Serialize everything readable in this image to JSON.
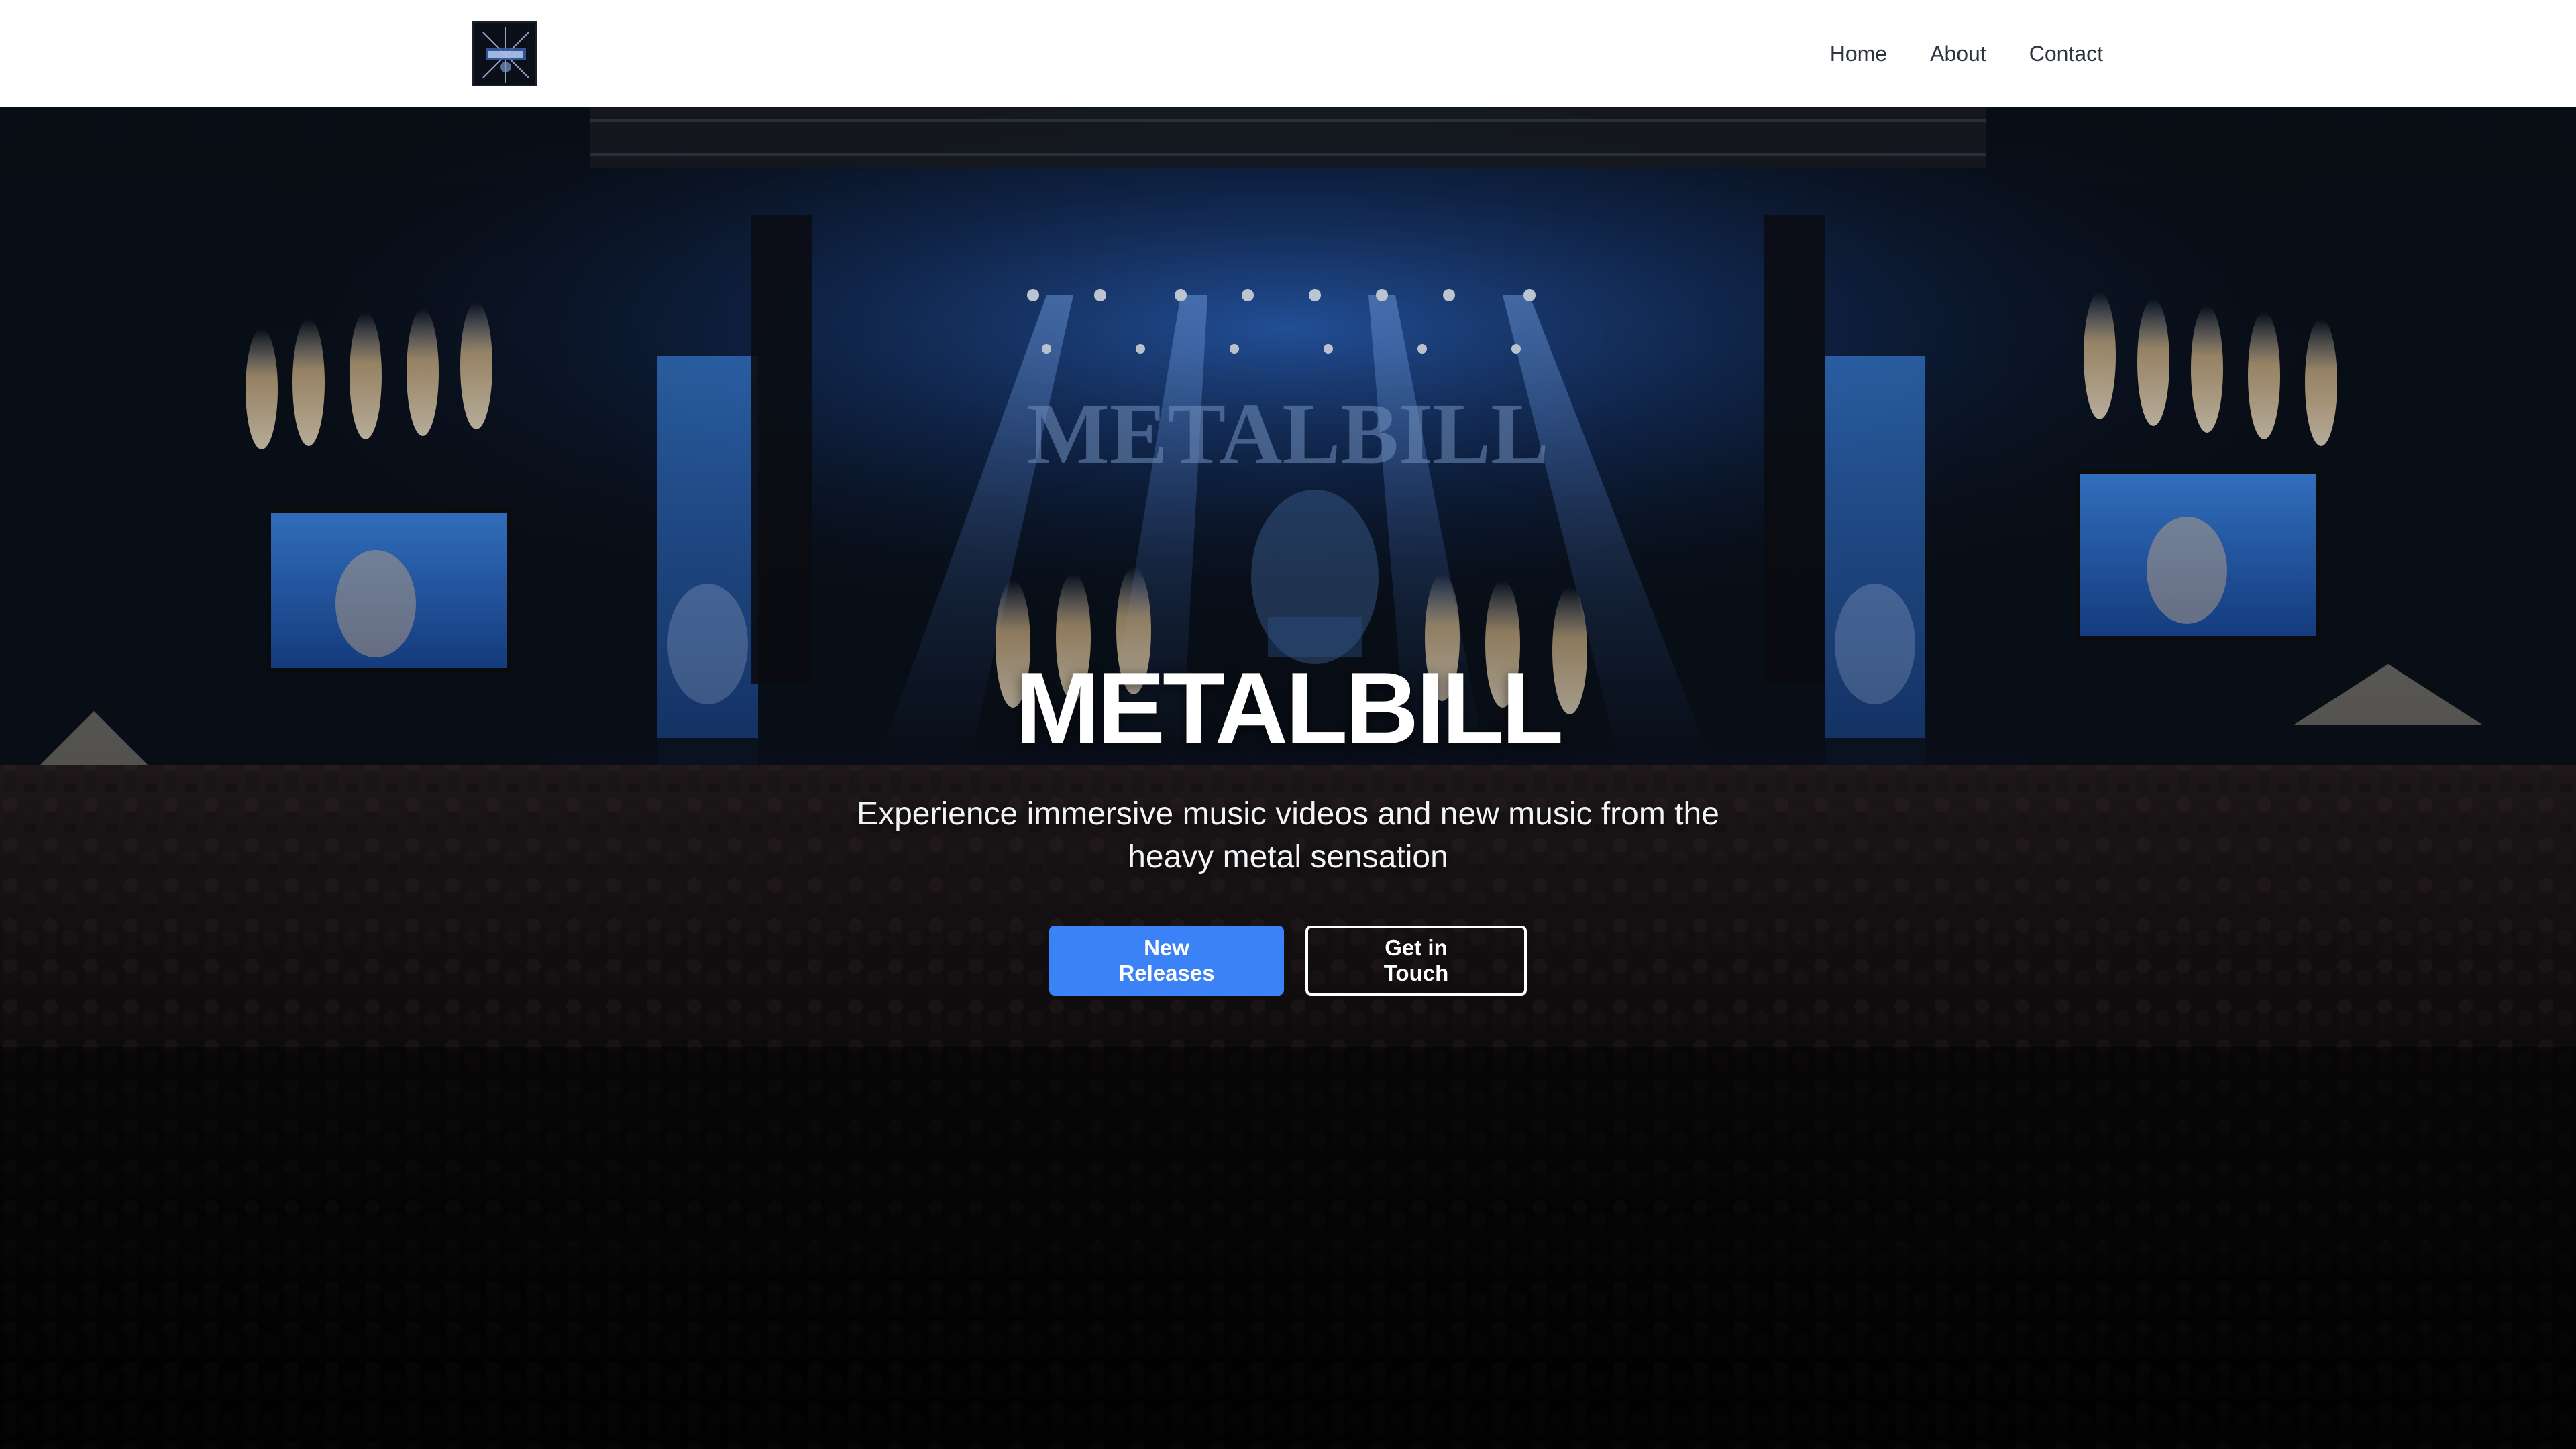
{
  "nav": {
    "logo_icon": "metalbill-logo-icon",
    "links": [
      {
        "label": "Home"
      },
      {
        "label": "About"
      },
      {
        "label": "Contact"
      }
    ]
  },
  "hero": {
    "background": "concert-stage-crowd-image",
    "stage_banner_text": "METALBILL",
    "title": "METALBILL",
    "subtitle": "Experience immersive music videos and new music from the heavy metal sensation",
    "buttons": {
      "primary_label": "New Releases",
      "secondary_label": "Get in Touch"
    }
  },
  "colors": {
    "nav_background": "#ffffff",
    "nav_text": "#2e3440",
    "primary_button": "#3b82f6",
    "hero_text": "#ffffff",
    "stage_blue": "#1e5bbf"
  }
}
